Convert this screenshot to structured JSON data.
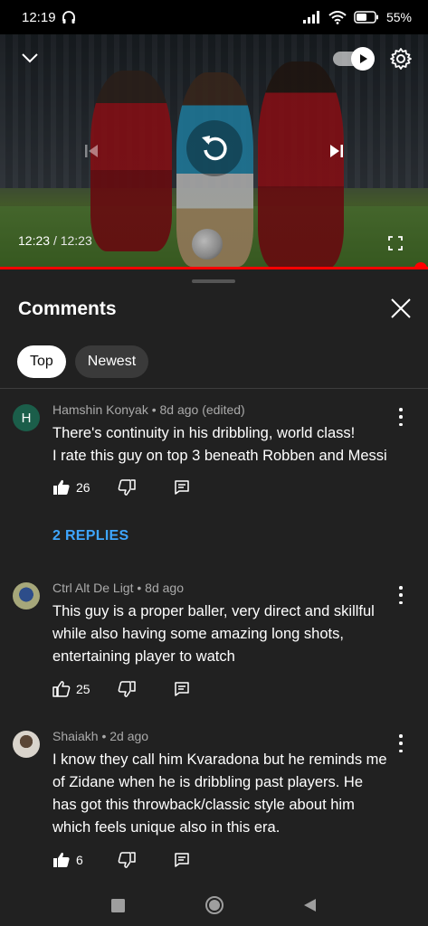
{
  "status_bar": {
    "time": "12:19",
    "battery": "55%",
    "icons": [
      "headphones-icon",
      "signal-icon",
      "wifi-icon",
      "battery-icon"
    ]
  },
  "player": {
    "current_time": "12:23",
    "separator": "/",
    "duration": "12:23",
    "progress": 1.0,
    "autoplay_on": true,
    "icons": [
      "chevron-down-icon",
      "autoplay-toggle-icon",
      "gear-icon",
      "previous-icon",
      "replay-icon",
      "next-icon",
      "fullscreen-icon"
    ]
  },
  "comments_panel": {
    "title": "Comments",
    "close_icon": "close-icon",
    "tabs": [
      {
        "label": "Top",
        "active": true
      },
      {
        "label": "Newest",
        "active": false
      }
    ]
  },
  "comments": [
    {
      "avatar_letter": "H",
      "author": "Hamshin Konyak",
      "meta": "Hamshin Konyak • 8d ago (edited)",
      "lines": [
        "There's continuity in his dribbling, world class!",
        "I rate this guy on top 3 beneath Robben and Messi"
      ],
      "likes": "26",
      "liked": true,
      "replies": "2 REPLIES"
    },
    {
      "avatar_letter": "",
      "author": "Ctrl Alt De Ligt",
      "meta": "Ctrl Alt De Ligt • 8d ago",
      "lines": [
        "This guy is a proper baller, very direct and skillful",
        "while also having some amazing long shots,",
        "entertaining player to watch"
      ],
      "likes": "25",
      "liked": false
    },
    {
      "avatar_letter": "",
      "author": "Shaiakh",
      "meta": "Shaiakh • 2d ago",
      "lines": [
        "I know they call him Kvaradona but he reminds me",
        "of Zidane when he is dribbling past players. He",
        "has got this throwback/classic style about him",
        "which feels unique also in this era."
      ],
      "likes": "6",
      "liked": true
    }
  ],
  "colors": {
    "accent_red": "#ff0000",
    "link_blue": "#3ea6ff",
    "panel_bg": "#212121"
  }
}
